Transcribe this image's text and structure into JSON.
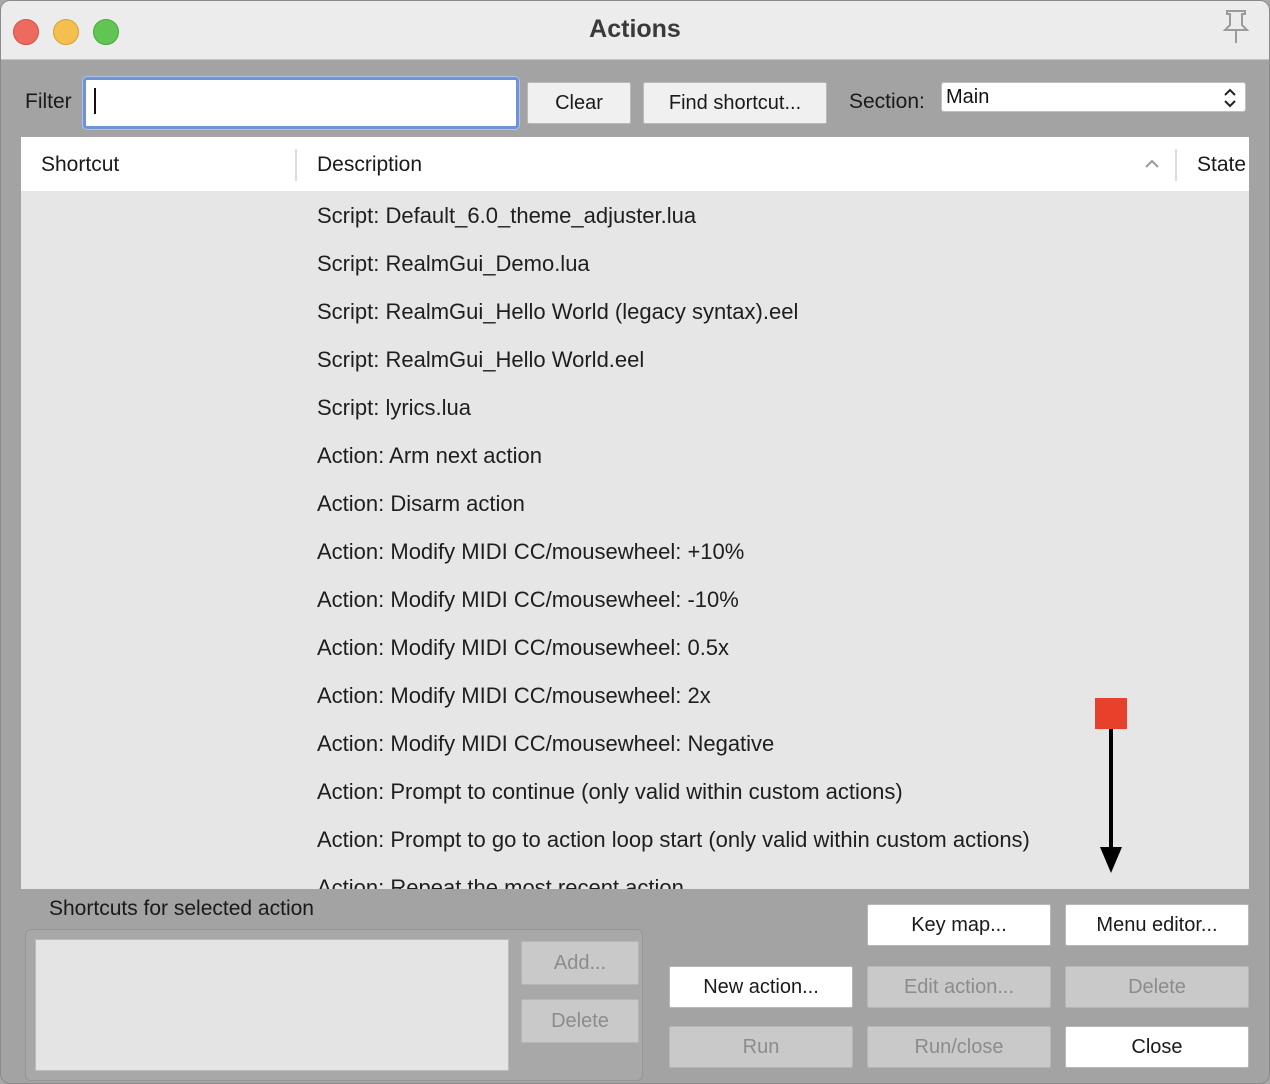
{
  "window": {
    "title": "Actions"
  },
  "toolbar": {
    "filter_label": "Filter",
    "filter_value": "",
    "clear_label": "Clear",
    "find_shortcut_label": "Find shortcut...",
    "section_label": "Section:",
    "section_value": "Main"
  },
  "list": {
    "columns": [
      "Shortcut",
      "Description",
      "State"
    ],
    "sort_column": "Description",
    "rows": [
      "Script: Default_6.0_theme_adjuster.lua",
      "Script: RealmGui_Demo.lua",
      "Script: RealmGui_Hello World (legacy syntax).eel",
      "Script: RealmGui_Hello World.eel",
      "Script: lyrics.lua",
      "Action: Arm next action",
      "Action: Disarm action",
      "Action: Modify MIDI CC/mousewheel: +10%",
      "Action: Modify MIDI CC/mousewheel: -10%",
      "Action: Modify MIDI CC/mousewheel: 0.5x",
      "Action: Modify MIDI CC/mousewheel: 2x",
      "Action: Modify MIDI CC/mousewheel: Negative",
      "Action: Prompt to continue (only valid within custom actions)",
      "Action: Prompt to go to action loop start (only valid within custom actions)",
      "Action: Repeat the most recent action"
    ]
  },
  "shortcuts": {
    "label": "Shortcuts for selected action",
    "add_label": "Add...",
    "delete_label": "Delete"
  },
  "buttons": {
    "key_map": "Key map...",
    "menu_editor": "Menu editor...",
    "new_action": "New action...",
    "edit_action": "Edit action...",
    "delete": "Delete",
    "run": "Run",
    "run_close": "Run/close",
    "close": "Close"
  },
  "colors": {
    "accent_focus": "#6f93d6",
    "marker": "#e8412b"
  },
  "icons": {
    "pin": "pin-icon",
    "select_arrows": "updown-chevron-icon",
    "sort": "chevron-up-icon"
  }
}
